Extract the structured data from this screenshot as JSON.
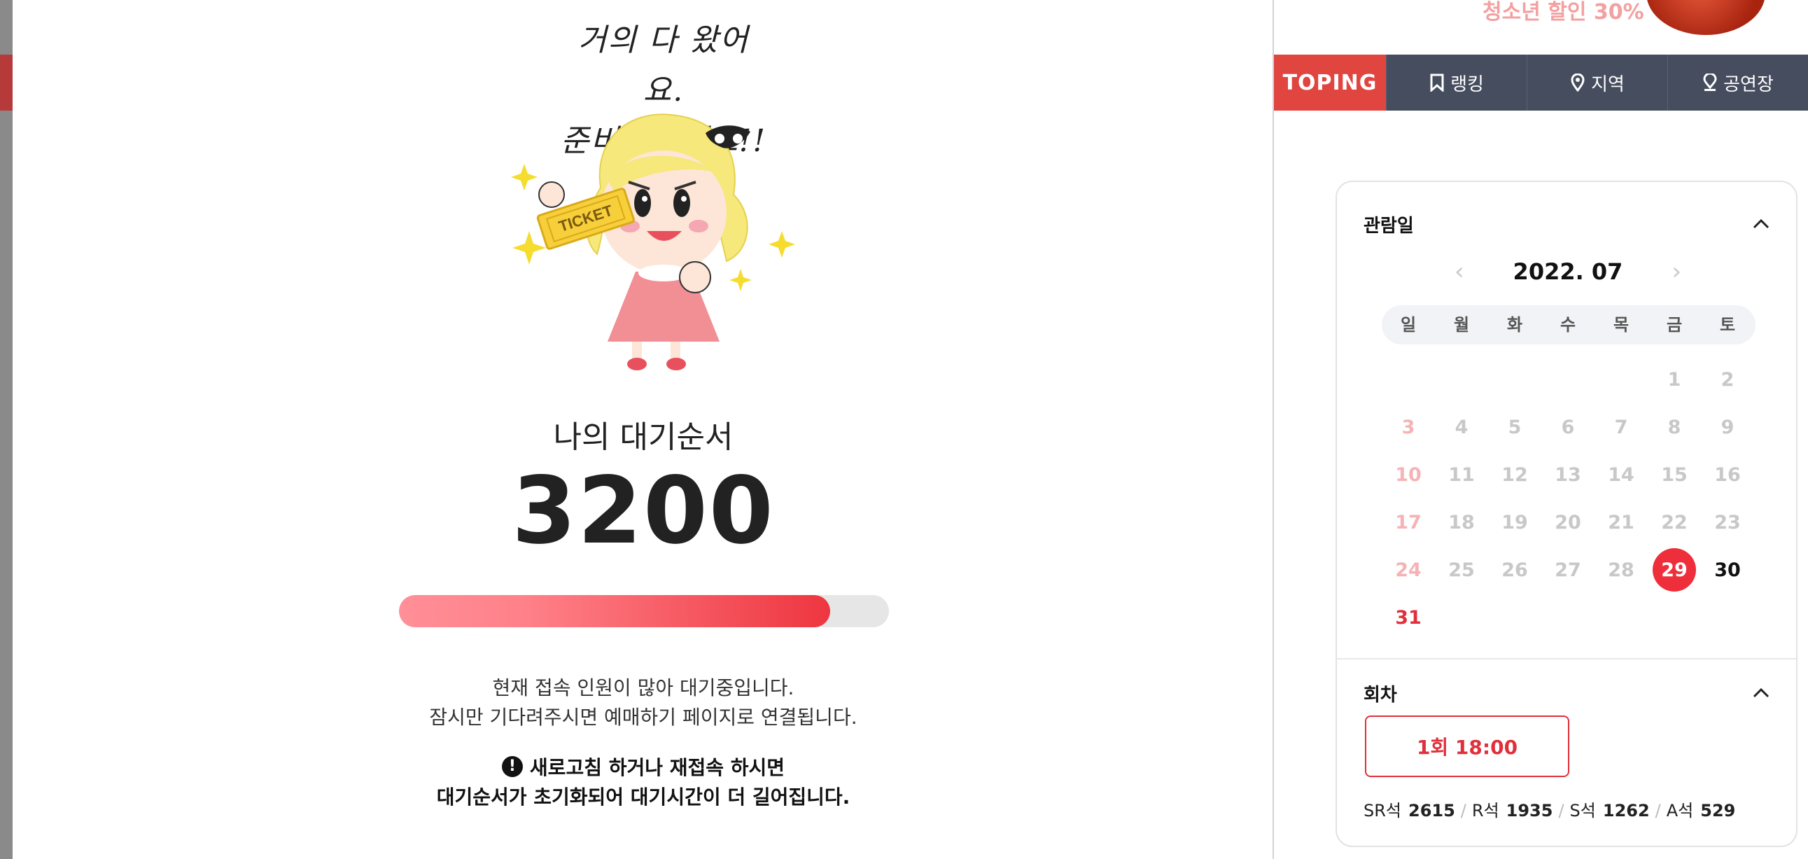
{
  "promo": {
    "text": "청소년 할인 30%"
  },
  "nav": {
    "brand": "TOPING",
    "items": [
      {
        "label": "랭킹",
        "icon": "bookmark-icon"
      },
      {
        "label": "지역",
        "icon": "map-pin-icon"
      },
      {
        "label": "공연장",
        "icon": "location-pin-icon"
      }
    ]
  },
  "booking": {
    "date_title": "관람일",
    "month": "2022. 07",
    "weekdays": [
      "일",
      "월",
      "화",
      "수",
      "목",
      "금",
      "토"
    ],
    "calendar": [
      [
        "",
        "",
        "",
        "",
        "",
        "1",
        "2"
      ],
      [
        "3",
        "4",
        "5",
        "6",
        "7",
        "8",
        "9"
      ],
      [
        "10",
        "11",
        "12",
        "13",
        "14",
        "15",
        "16"
      ],
      [
        "17",
        "18",
        "19",
        "20",
        "21",
        "22",
        "23"
      ],
      [
        "24",
        "25",
        "26",
        "27",
        "28",
        "29",
        "30"
      ],
      [
        "31",
        "",
        "",
        "",
        "",
        "",
        ""
      ]
    ],
    "selected_day": "29",
    "available_days": [
      "29",
      "30",
      "31"
    ],
    "round_title": "회차",
    "session": "1회 18:00",
    "seats": [
      {
        "grade": "SR석",
        "count": "2615"
      },
      {
        "grade": "R석",
        "count": "1935"
      },
      {
        "grade": "S석",
        "count": "1262"
      },
      {
        "grade": "A석",
        "count": "529"
      }
    ],
    "colors": {
      "accent": "#e0303c",
      "selected": "#ee2f3b"
    }
  },
  "queue": {
    "handwriting_line1": "거의 다 왔어요.",
    "handwriting_line2": "준비해주세요!!",
    "ticket_text": "TICKET",
    "label": "나의 대기순서",
    "number": "3200",
    "progress": 0.88,
    "status_line1": "현재 접속 인원이 많아 대기중입니다.",
    "status_line2": "잠시만 기다려주시면 예매하기 페이지로 연결됩니다.",
    "warning_line1": "새로고침 하거나 재접속 하시면",
    "warning_line2": "대기순서가 초기화되어 대기시간이 더 길어집니다.",
    "warning_icon": "exclamation-circle-icon"
  }
}
